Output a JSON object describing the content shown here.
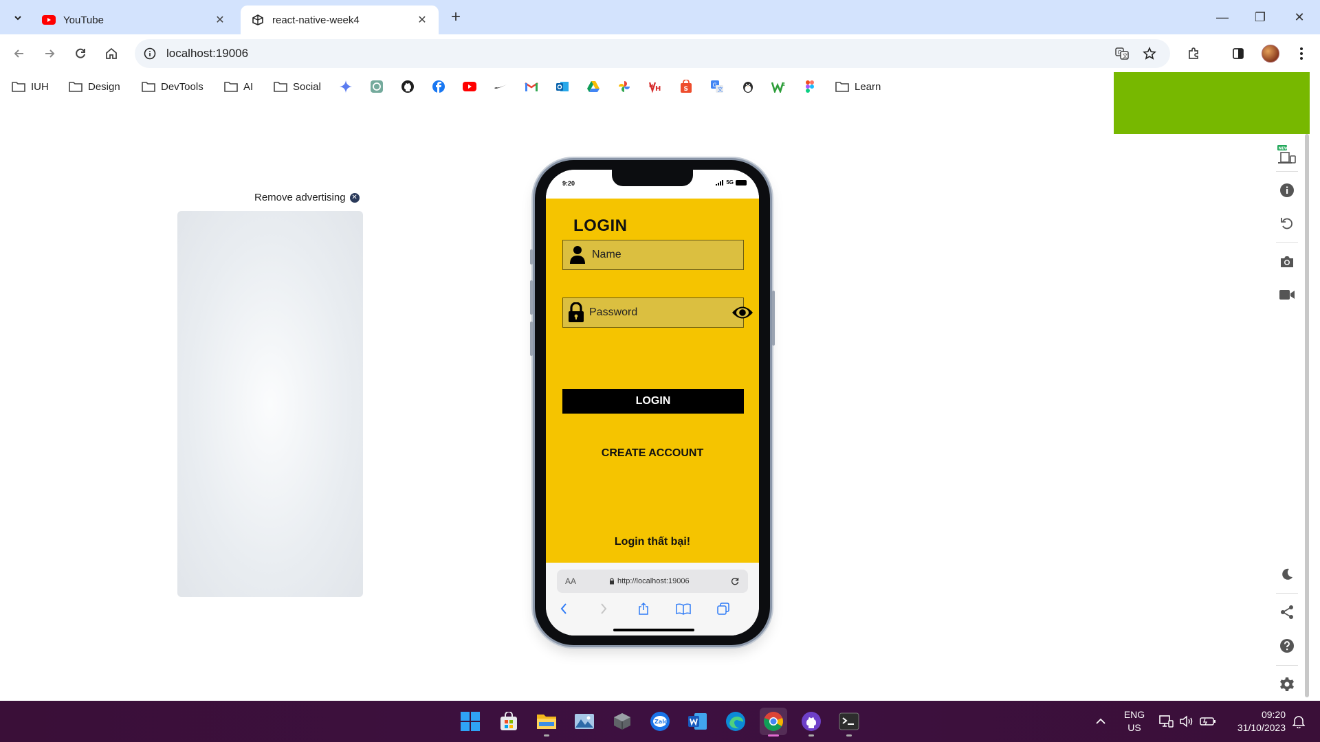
{
  "browser": {
    "tabs": [
      {
        "title": "YouTube",
        "favicon": "youtube-icon",
        "active": false
      },
      {
        "title": "react-native-week4",
        "favicon": "expo-icon",
        "active": true
      }
    ],
    "new_tab": "+",
    "url": "localhost:19006",
    "window_controls": {
      "minimize": "—",
      "restore": "❐",
      "close": "✕"
    }
  },
  "bookmarks": {
    "folders": [
      {
        "label": "IUH"
      },
      {
        "label": "Design"
      },
      {
        "label": "DevTools"
      },
      {
        "label": "AI"
      },
      {
        "label": "Social"
      },
      {
        "label": "Learn"
      }
    ],
    "icons": [
      "gemini-icon",
      "chatgpt-icon",
      "github-icon",
      "facebook-icon",
      "youtube-icon",
      "nike-icon",
      "gmail-icon",
      "outlook-icon",
      "drive-icon",
      "photos-icon",
      "vieon-icon",
      "shopee-icon",
      "translate-icon",
      "penguin-icon",
      "wordwall-icon",
      "figma-icon"
    ]
  },
  "ad": {
    "remove_label": "Remove advertising"
  },
  "phone": {
    "status_time": "9:20",
    "network": "5G",
    "app": {
      "title": "LOGIN",
      "name_placeholder": "Name",
      "password_placeholder": "Password",
      "login_button": "LOGIN",
      "create_account": "CREATE ACCOUNT",
      "message": "Login thất bại!"
    },
    "safari": {
      "aa": "AA",
      "address": "http://localhost:19006"
    }
  },
  "tray": {
    "lang_line1": "ENG",
    "lang_line2": "US",
    "time": "09:20",
    "date": "31/10/2023"
  },
  "colors": {
    "app_background": "#f5c400",
    "field_background": "#dbbf40",
    "accent_green": "#77b800",
    "taskbar": "#3a0f38"
  }
}
